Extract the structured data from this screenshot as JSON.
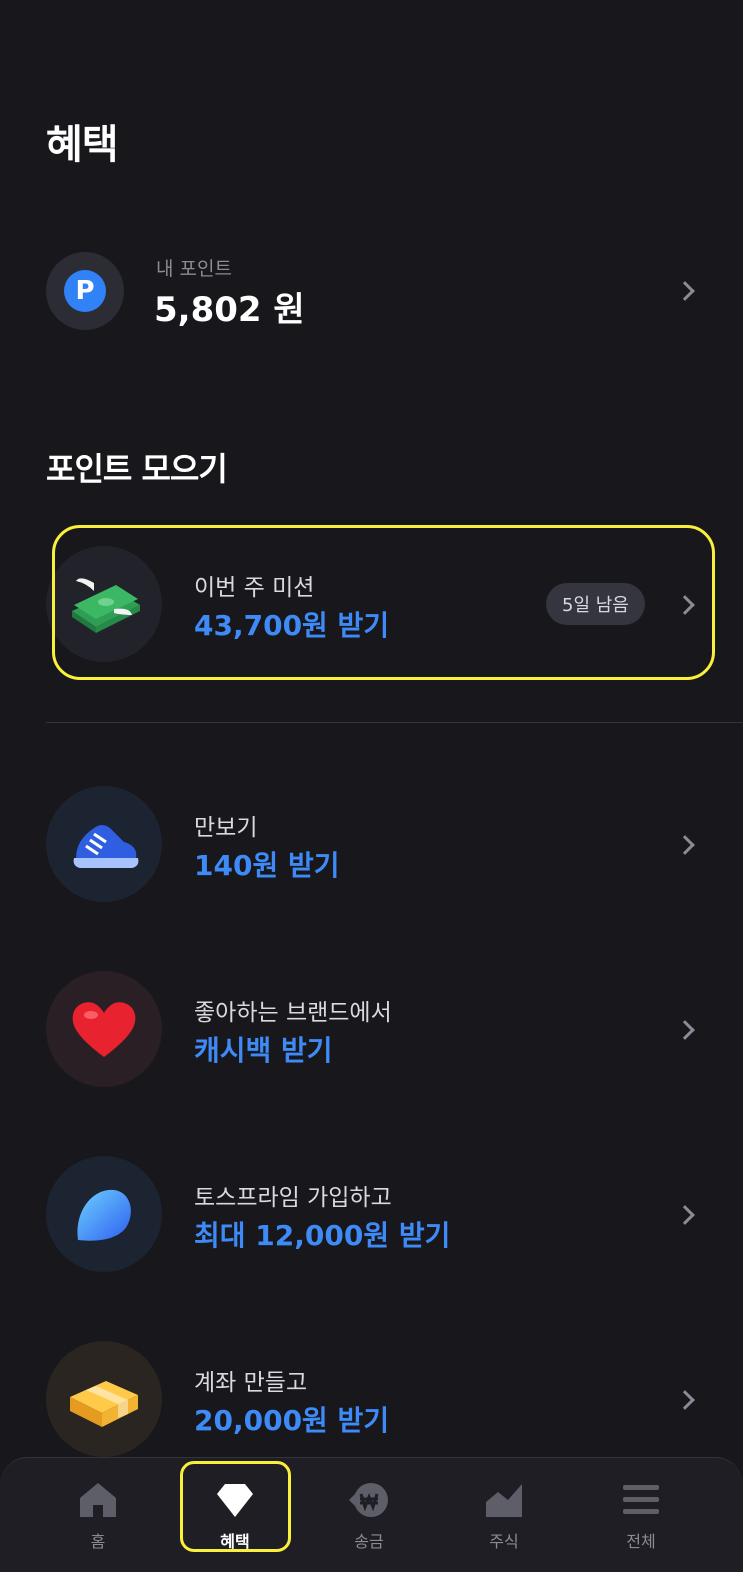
{
  "page": {
    "title": "혜택"
  },
  "points": {
    "label": "내 포인트",
    "value": "5,802 원",
    "badge_letter": "P"
  },
  "section": {
    "title": "포인트 모으기"
  },
  "items": [
    {
      "title": "이번 주 미션",
      "reward": "43,700원 받기",
      "badge": "5일 남음",
      "icon": "winged-money-icon"
    },
    {
      "title": "만보기",
      "reward": "140원 받기",
      "icon": "sneaker-icon"
    },
    {
      "title": "좋아하는 브랜드에서",
      "reward": "캐시백 받기",
      "icon": "heart-icon"
    },
    {
      "title": "토스프라임 가입하고",
      "reward": "최대 12,000원 받기",
      "icon": "toss-prime-icon"
    },
    {
      "title": "계좌 만들고",
      "reward": "20,000원 받기",
      "icon": "gift-box-icon"
    }
  ],
  "nav": [
    {
      "label": "홈",
      "icon": "home-icon"
    },
    {
      "label": "혜택",
      "icon": "diamond-icon",
      "active": true
    },
    {
      "label": "송금",
      "icon": "won-transfer-icon"
    },
    {
      "label": "주식",
      "icon": "stock-chart-icon"
    },
    {
      "label": "전체",
      "icon": "menu-icon"
    }
  ],
  "colors": {
    "background": "#17171c",
    "accent": "#3e8bf7",
    "highlight": "#f8f03a"
  }
}
